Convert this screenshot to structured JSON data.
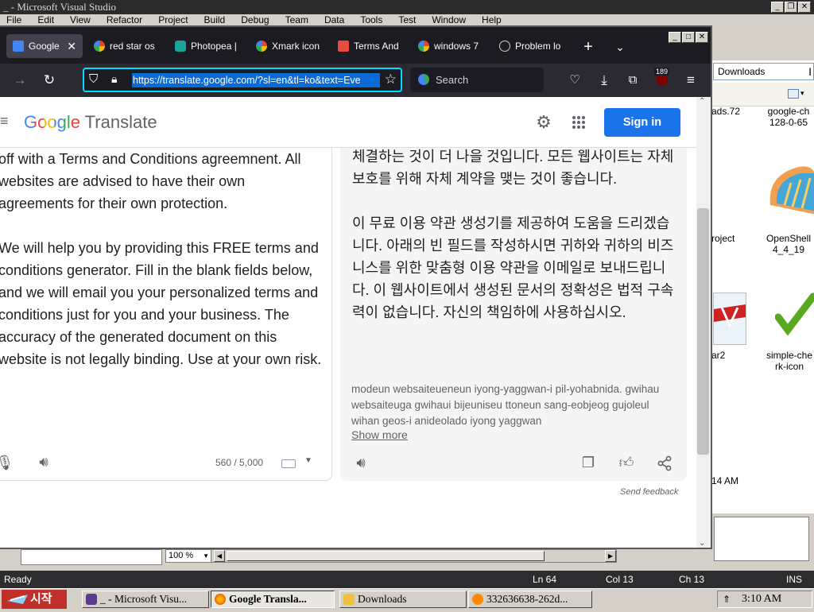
{
  "vs": {
    "title": "_ - Microsoft Visual Studio",
    "menu": [
      "File",
      "Edit",
      "View",
      "Refactor",
      "Project",
      "Build",
      "Debug",
      "Team",
      "Data",
      "Tools",
      "Test",
      "Window",
      "Help"
    ],
    "zoom": "100 %",
    "status": {
      "ready": "Ready",
      "ln": "Ln 64",
      "col": "Col 13",
      "ch": "Ch 13",
      "ins": "INS"
    }
  },
  "explorer": {
    "address": "Downloads",
    "items": [
      {
        "label": "ads.72"
      },
      {
        "label": "google-ch 128-0-65"
      },
      {
        "label": "roject"
      },
      {
        "label": "OpenShell 4_4_19"
      },
      {
        "label": "ar2"
      },
      {
        "label": "simple-che rk-icon"
      }
    ],
    "time_fragment": "14 AM"
  },
  "browser": {
    "tabs": [
      {
        "label": "Google",
        "icon_color": "#4285f4"
      },
      {
        "label": "red star os",
        "icon_color": "#ffffff"
      },
      {
        "label": "Photopea |",
        "icon_color": "#18a497"
      },
      {
        "label": "Xmark icon",
        "icon_color": "#ffffff"
      },
      {
        "label": "Terms And",
        "icon_color": "#e74c3c"
      },
      {
        "label": "windows 7",
        "icon_color": "#ffffff"
      },
      {
        "label": "Problem lo",
        "icon_color": "#cccccc"
      }
    ],
    "url": "https://translate.google.com/?sl=en&tl=ko&text=Eve",
    "search_placeholder": "Search",
    "badge": "189"
  },
  "translate": {
    "logo_google": "Google",
    "logo_translate": "Translate",
    "signin": "Sign in",
    "source_paragraphs": [
      "off with a Terms and Conditions agreemnent. All websites are advised to have their own agreements for their own protection.",
      "We will help you by providing this FREE terms and conditions generator. Fill in the blank fields below, and we will email you your personalized terms and conditions just for you and your business. The accuracy of the generated document on this website is not legally binding. Use at your own risk."
    ],
    "target_paragraphs": [
      "체결하는 것이 더 나을 것입니다. 모든 웹사이트는 자체 보호를 위해 자체 계약을 맺는 것이 좋습니다.",
      "이 무료 이용 약관 생성기를 제공하여 도움을 드리겠습니다. 아래의 빈 필드를 작성하시면 귀하와 귀하의 비즈니스를 위한 맞춤형 이용 약관을 이메일로 보내드립니다. 이 웹사이트에서 생성된 문서의 정확성은 법적 구속력이 없습니다. 자신의 책임하에 사용하십시오."
    ],
    "transliteration": "modeun websaiteueneun iyong-yaggwan-i pil-yohabnida. gwihau websaiteuga gwihaui bijeuniseu ttoneun sang-eobjeog gujoleul wihan geos-i anideolado iyong yaggwan",
    "show_more": "Show more",
    "char_count": "560 / 5,000",
    "send_feedback": "Send feedback"
  },
  "taskbar": {
    "start": "시작",
    "tasks": [
      {
        "label": "_ - Microsoft Visu...",
        "active": false,
        "color": "#5b3a8c"
      },
      {
        "label": "Google Transla...",
        "active": true,
        "color": "#e66000"
      },
      {
        "label": "Downloads",
        "active": false,
        "color": "#f0c040"
      },
      {
        "label": "332636638-262d...",
        "active": false,
        "color": "#ff8800"
      }
    ],
    "clock": "3:10 AM"
  }
}
